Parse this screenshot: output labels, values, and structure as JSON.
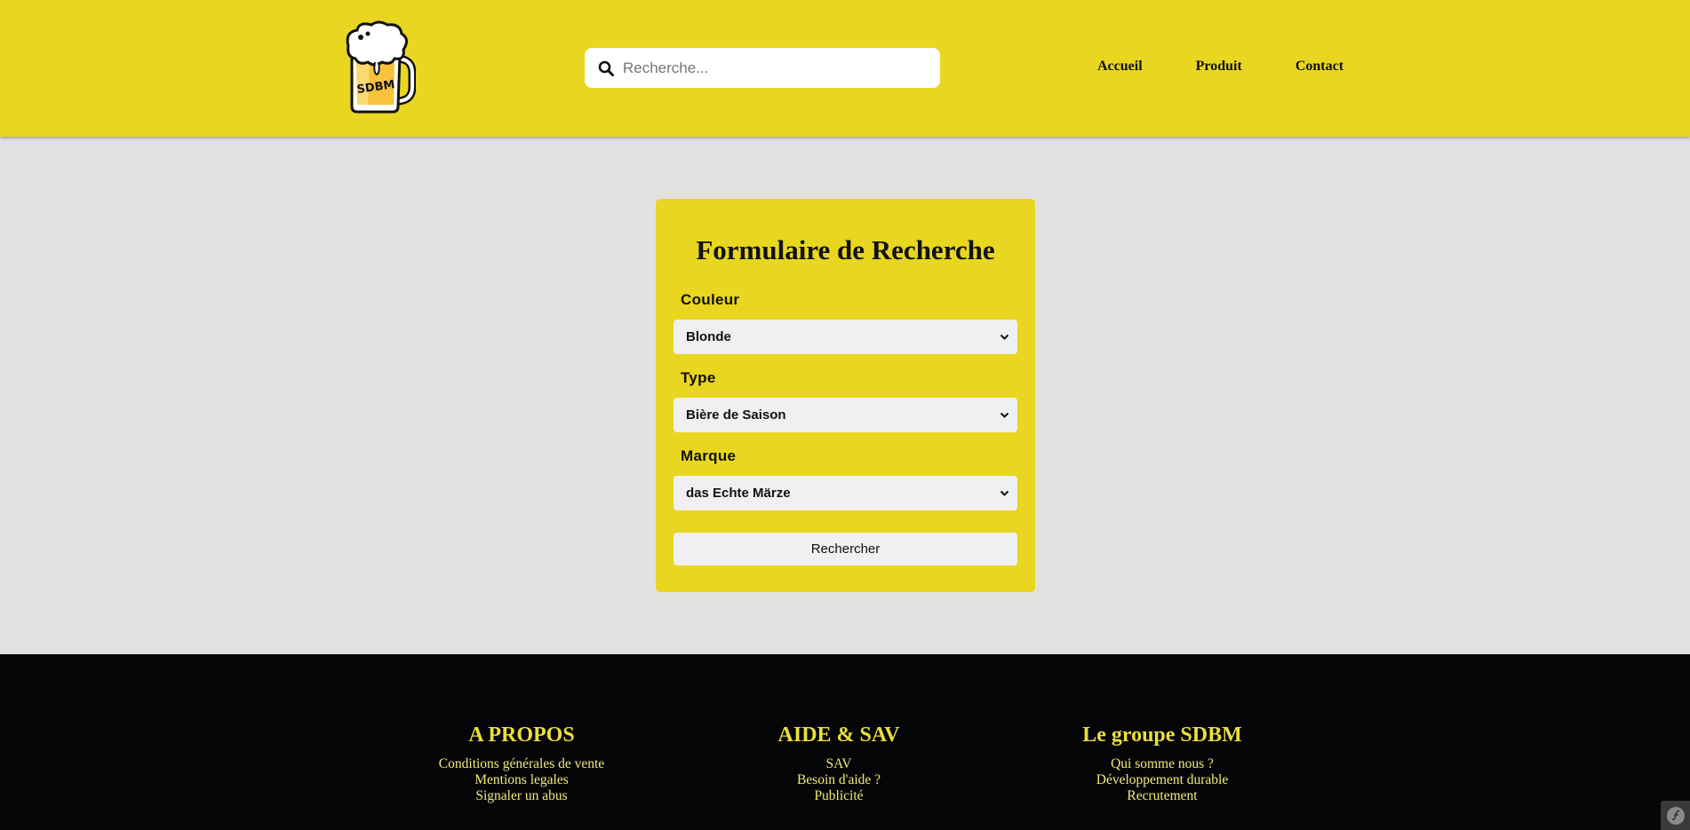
{
  "header": {
    "logo_text": "SDBM",
    "search": {
      "placeholder": "Recherche...",
      "value": ""
    },
    "nav": [
      {
        "label": "Accueil"
      },
      {
        "label": "Produit"
      },
      {
        "label": "Contact"
      }
    ]
  },
  "form": {
    "title": "Formulaire de Recherche",
    "fields": [
      {
        "label": "Couleur",
        "value": "Blonde"
      },
      {
        "label": "Type",
        "value": "Bière de Saison"
      },
      {
        "label": "Marque",
        "value": "das Echte Märze"
      }
    ],
    "submit_label": "Rechercher"
  },
  "footer": {
    "columns": [
      {
        "title": "A PROPOS",
        "links": [
          "Conditions générales de vente",
          "Mentions legales",
          "Signaler un abus"
        ]
      },
      {
        "title": "AIDE & SAV",
        "links": [
          "SAV",
          "Besoin d'aide ?",
          "Publicité"
        ]
      },
      {
        "title": "Le groupe SDBM",
        "links": [
          "Qui somme nous ?",
          "Développement durable",
          "Recrutement"
        ]
      }
    ]
  },
  "colors": {
    "header_bg": "#e9d620",
    "page_bg": "#e3e1df",
    "footer_bg": "#050507",
    "footer_title": "#eadf3c",
    "footer_link": "#f2ea7a"
  },
  "icons": [
    "beer-mug-logo",
    "search-icon",
    "chevron-down-icon",
    "symfony-icon"
  ]
}
